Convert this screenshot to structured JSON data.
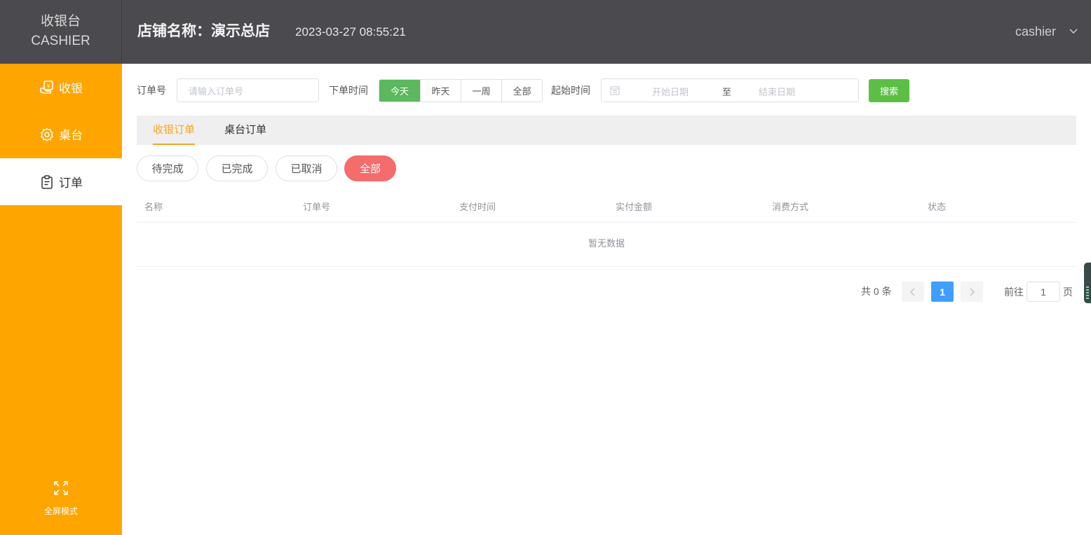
{
  "brand": {
    "title_cn": "收银台",
    "title_en": "CASHIER"
  },
  "header": {
    "shop": "店铺名称：演示总店",
    "datetime": "2023-03-27 08:55:21",
    "user": "cashier"
  },
  "sidebar": {
    "items": [
      {
        "label": "收银",
        "icon": "cash-register-icon"
      },
      {
        "label": "桌台",
        "icon": "gear-icon"
      },
      {
        "label": "订单",
        "icon": "clipboard-icon"
      }
    ],
    "fullscreen_label": "全屏模式"
  },
  "filters": {
    "order_no_label": "订单号",
    "order_no_placeholder": "请输入订单号",
    "order_time_label": "下单时间",
    "time_options": [
      "今天",
      "昨天",
      "一周",
      "全部"
    ],
    "start_time_label": "起始时间",
    "start_date_placeholder": "开始日期",
    "range_sep": "至",
    "end_date_placeholder": "结束日期",
    "search_label": "搜索"
  },
  "tabs": [
    "收银订单",
    "桌台订单"
  ],
  "status_filters": [
    "待完成",
    "已完成",
    "已取消",
    "全部"
  ],
  "table": {
    "columns": [
      "名称",
      "订单号",
      "支付时间",
      "实付金额",
      "消费方式",
      "状态"
    ],
    "empty_text": "暂无数据"
  },
  "pagination": {
    "total": "共 0 条",
    "current": "1",
    "goto_label": "前往",
    "goto_value": "1",
    "page_suffix": "页"
  },
  "colors": {
    "sidebar": "#ffa500",
    "header": "#4a4a4f",
    "accent_green": "#5cb85c",
    "active_pill": "#f56c6c",
    "page_active": "#409eff",
    "tab_active": "#f5a623"
  }
}
